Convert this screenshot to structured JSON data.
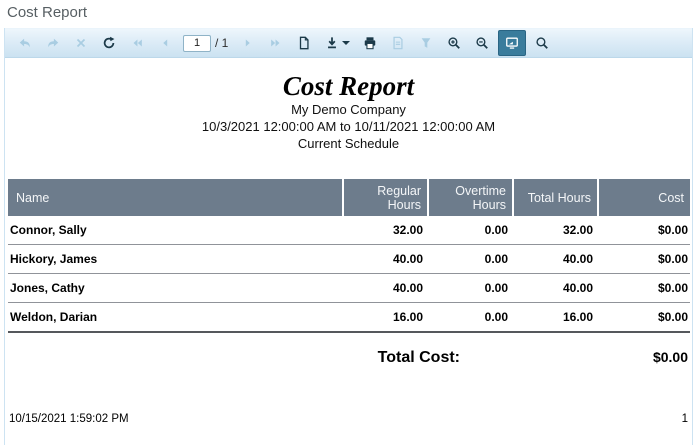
{
  "window": {
    "title": "Cost Report"
  },
  "toolbar": {
    "items": [
      {
        "kind": "button",
        "name": "navigate-back",
        "icon": "back-arrow-icon",
        "enabled": false
      },
      {
        "kind": "button",
        "name": "navigate-forward",
        "icon": "forward-arrow-icon",
        "enabled": false
      },
      {
        "kind": "button",
        "name": "cancel",
        "icon": "cancel-icon",
        "enabled": false
      },
      {
        "kind": "button",
        "name": "refresh",
        "icon": "refresh-icon",
        "enabled": true
      },
      {
        "kind": "button",
        "name": "first-page",
        "icon": "first-page-icon",
        "enabled": false
      },
      {
        "kind": "button",
        "name": "previous-page",
        "icon": "prev-page-icon",
        "enabled": false
      },
      {
        "kind": "input",
        "name": "page-number",
        "value": "1"
      },
      {
        "kind": "label",
        "name": "page-count",
        "text": "/ 1"
      },
      {
        "kind": "button",
        "name": "next-page",
        "icon": "next-page-icon",
        "enabled": false
      },
      {
        "kind": "button",
        "name": "last-page",
        "icon": "last-page-icon",
        "enabled": false
      },
      {
        "kind": "button",
        "name": "page-setup",
        "icon": "page-icon",
        "enabled": true
      },
      {
        "kind": "button",
        "name": "export",
        "icon": "download-icon",
        "enabled": true,
        "dropdown": true
      },
      {
        "kind": "button",
        "name": "print",
        "icon": "printer-icon",
        "enabled": true
      },
      {
        "kind": "button",
        "name": "print-preview",
        "icon": "document-preview-icon",
        "enabled": false
      },
      {
        "kind": "button",
        "name": "filter",
        "icon": "funnel-icon",
        "enabled": false
      },
      {
        "kind": "button",
        "name": "zoom-in",
        "icon": "zoom-in-icon",
        "enabled": true
      },
      {
        "kind": "button",
        "name": "zoom-out",
        "icon": "zoom-out-icon",
        "enabled": true
      },
      {
        "kind": "button",
        "name": "fit-to-window",
        "icon": "monitor-icon",
        "enabled": true,
        "active": true
      },
      {
        "kind": "button",
        "name": "search",
        "icon": "search-icon",
        "enabled": true
      }
    ]
  },
  "report": {
    "title": "Cost Report",
    "company": "My Demo Company",
    "date_range": "10/3/2021 12:00:00 AM to 10/11/2021 12:00:00 AM",
    "schedule": "Current Schedule",
    "table": {
      "columns": [
        "Name",
        "Regular Hours",
        "Overtime Hours",
        "Total Hours",
        "Cost"
      ],
      "rows": [
        {
          "name": "Connor, Sally",
          "regular": "32.00",
          "overtime": "0.00",
          "total": "32.00",
          "cost": "$0.00"
        },
        {
          "name": "Hickory, James",
          "regular": "40.00",
          "overtime": "0.00",
          "total": "40.00",
          "cost": "$0.00"
        },
        {
          "name": "Jones, Cathy",
          "regular": "40.00",
          "overtime": "0.00",
          "total": "40.00",
          "cost": "$0.00"
        },
        {
          "name": "Weldon, Darian",
          "regular": "16.00",
          "overtime": "0.00",
          "total": "16.00",
          "cost": "$0.00"
        }
      ]
    },
    "total_label": "Total Cost:",
    "total_value": "$0.00",
    "footer": {
      "generated": "10/15/2021 1:59:02 PM",
      "page_number": "1"
    }
  },
  "colors": {
    "toolbar_active_bg": "#3a7c9c",
    "toolbar_icon": "#1c3a49",
    "toolbar_icon_disabled": "#a9cde2",
    "table_header_bg": "#6d7c8c",
    "row_divider": "#909399"
  }
}
